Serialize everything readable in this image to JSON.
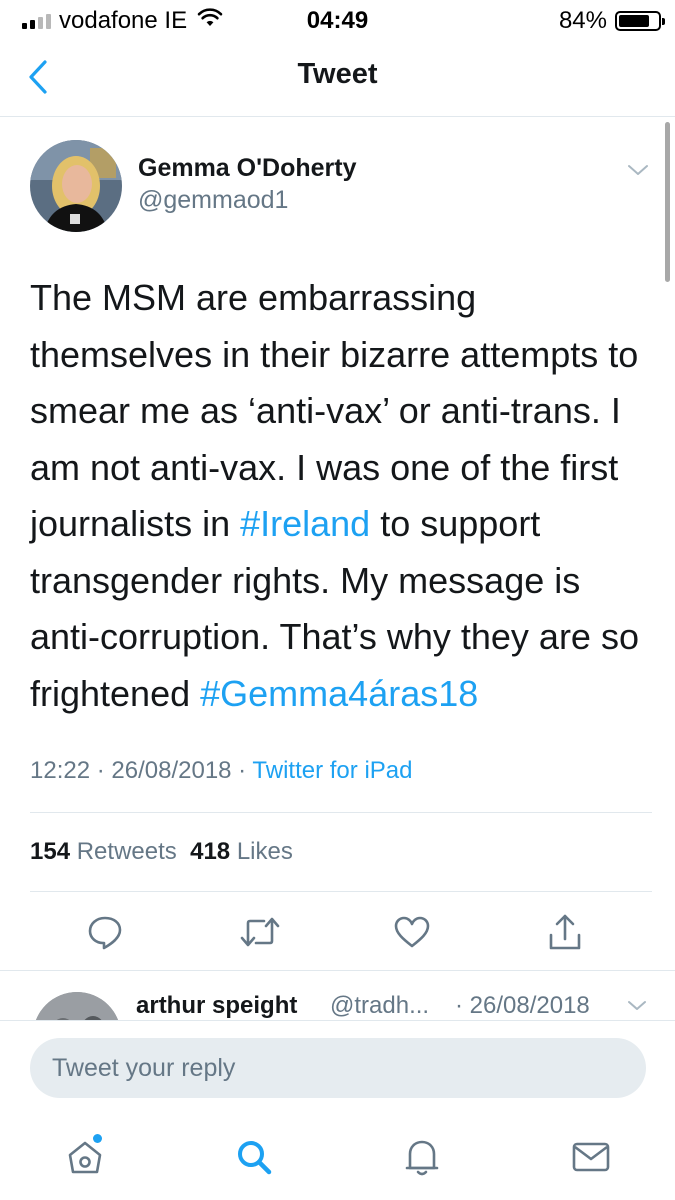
{
  "status_bar": {
    "carrier": "vodafone IE",
    "time": "04:49",
    "battery_percent": "84%",
    "battery_level": 0.84,
    "signal_bars": 4,
    "signal_bars_filled": 2
  },
  "nav": {
    "back_icon": "chevron-left-icon",
    "title": "Tweet"
  },
  "tweet": {
    "author": {
      "name": "Gemma O'Doherty",
      "handle": "@gemmaod1"
    },
    "text_parts": {
      "p1": "The MSM are embarrassing themselves in their bizarre attempts to smear me as ‘anti-vax’ or anti-trans. I am not anti-vax. I was one of the first journalists in ",
      "h1": "#Ireland",
      "p2": " to support transgender rights. My message is anti-corruption. That’s why they are so frightened  ",
      "h2": "#Gemma4áras18"
    },
    "meta": {
      "time": "12:22",
      "date": "26/08/2018",
      "separator": " · ",
      "source": "Twitter for iPad"
    },
    "stats": {
      "retweets_count": "154",
      "retweets_label": "Retweets",
      "likes_count": "418",
      "likes_label": "Likes"
    },
    "actions": [
      "reply-icon",
      "retweet-icon",
      "like-icon",
      "share-icon"
    ]
  },
  "reply_preview": {
    "name": "arthur speight",
    "handle": "@tradh...",
    "date": "· 26/08/2018"
  },
  "compose": {
    "placeholder": "Tweet your reply"
  },
  "tabs": [
    "home-icon",
    "search-icon",
    "notifications-icon",
    "messages-icon"
  ],
  "colors": {
    "accent": "#1da1f2",
    "text": "#14171a",
    "secondary": "#657786",
    "divider": "#e1e8ed",
    "input_bg": "#e6ecf0"
  }
}
